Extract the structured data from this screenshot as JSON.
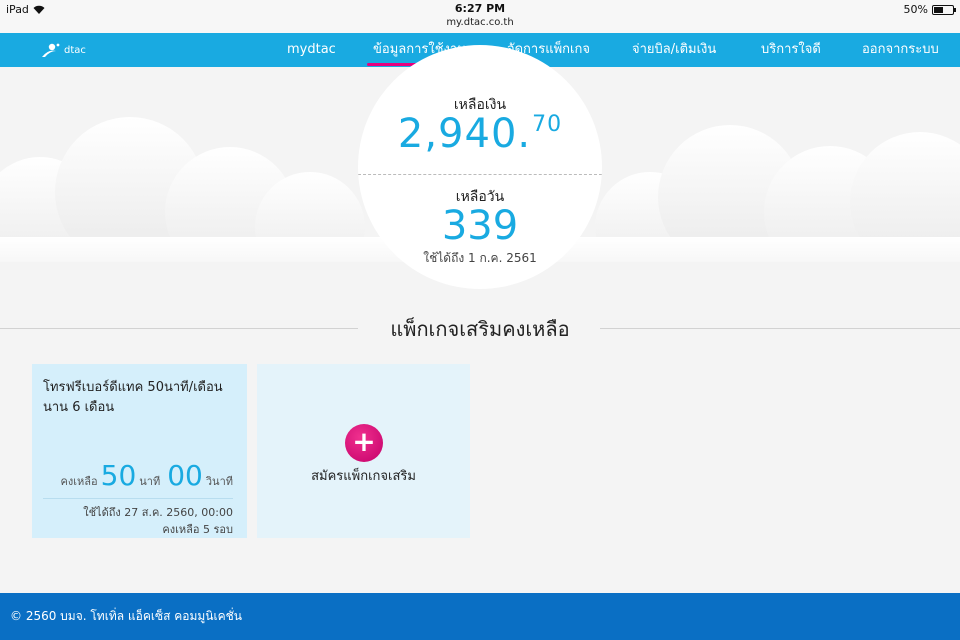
{
  "status_bar": {
    "device": "iPad",
    "time": "6:27 PM",
    "url": "my.dtac.co.th",
    "battery": "50%",
    "battery_level": 0.5
  },
  "nav": {
    "logo_text": "dtac",
    "items": [
      {
        "label": "mydtac",
        "active": false
      },
      {
        "label": "ข้อมูลการใช้งาน",
        "active": true
      },
      {
        "label": "จัดการแพ็กเกจ",
        "active": false
      },
      {
        "label": "จ่ายบิล/เติมเงิน",
        "active": false
      },
      {
        "label": "บริการใจดี",
        "active": false
      },
      {
        "label": "ออกจากระบบ",
        "active": false
      }
    ]
  },
  "balance": {
    "label": "เหลือเงิน",
    "amount_main": "2,940.",
    "amount_decimal": "70",
    "days_label": "เหลือวัน",
    "days": "339",
    "valid_until": "ใช้ได้ถึง 1 ก.ค. 2561"
  },
  "section_title": "แพ็กเกจเสริมคงเหลือ",
  "package": {
    "title": "โทรฟรีเบอร์ดีแทค 50นาที/เดือน นาน 6 เดือน",
    "remain_label": "คงเหลือ",
    "minutes": "50",
    "minutes_unit": "นาที",
    "seconds": "00",
    "seconds_unit": "วินาที",
    "valid_until": "ใช้ได้ถึง 27 ส.ค. 2560, 00:00",
    "rounds_left": "คงเหลือ 5 รอบ"
  },
  "add_package": {
    "icon": "+",
    "label": "สมัครแพ็กเกจเสริม"
  },
  "footer": {
    "text": "© 2560 บมจ. โทเทิ่ล แอ็คเซ็ส คอมมูนิเคชั่น"
  },
  "colors": {
    "brand_blue": "#19aae1",
    "accent_pink": "#e6007e",
    "footer_blue": "#0a6fc4"
  }
}
